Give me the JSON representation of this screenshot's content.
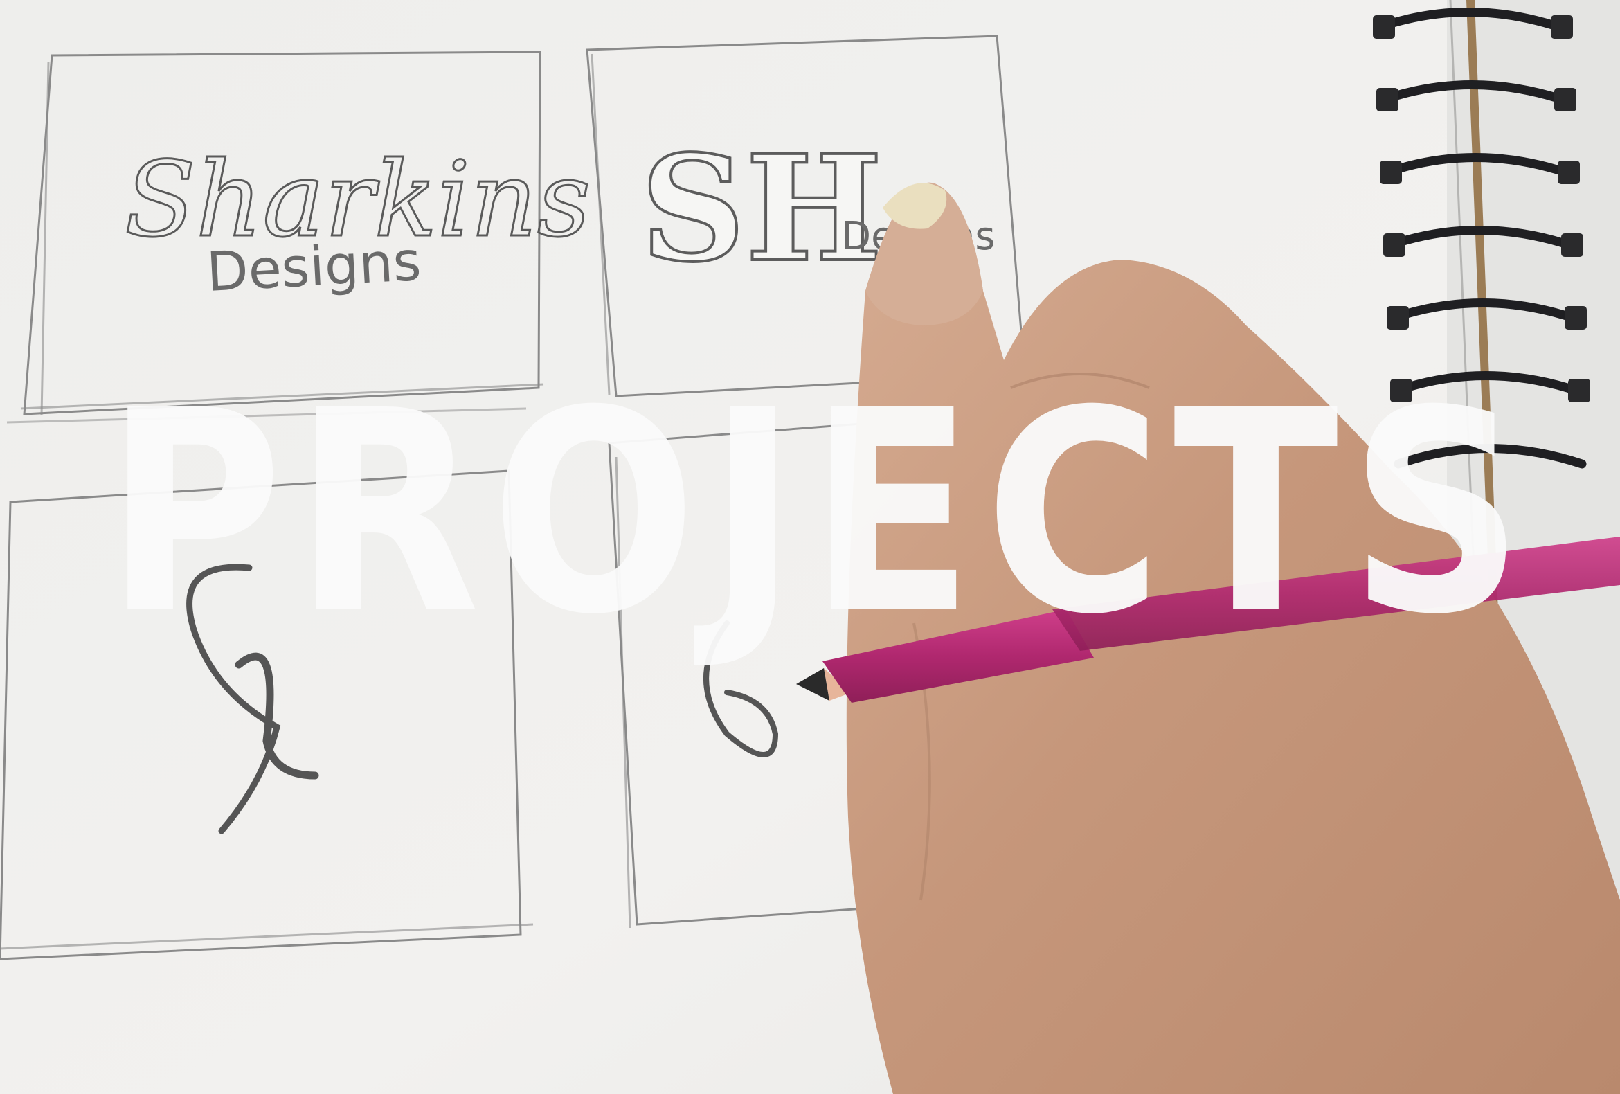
{
  "banner": {
    "title": "PROJECTS"
  },
  "sketches": [
    {
      "lines": [
        "Sharkins",
        "Designs"
      ]
    },
    {
      "lines": [
        "SH",
        "Designs"
      ]
    },
    {
      "lines": [
        "SH"
      ]
    },
    {
      "lines": [
        "8"
      ]
    }
  ],
  "colors": {
    "title": "#fafafa",
    "paper": "#f1f0ee",
    "pencil": "#b52b74",
    "skin": "#c99a7e",
    "spiral": "#1f1f22"
  }
}
